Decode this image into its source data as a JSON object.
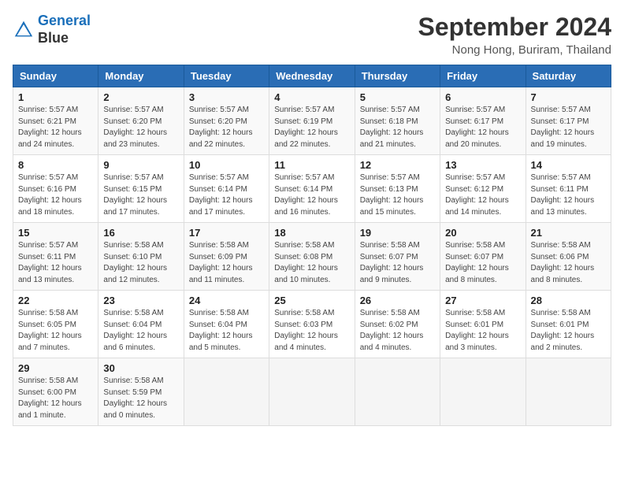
{
  "logo": {
    "line1": "General",
    "line2": "Blue"
  },
  "title": "September 2024",
  "subtitle": "Nong Hong, Buriram, Thailand",
  "days_of_week": [
    "Sunday",
    "Monday",
    "Tuesday",
    "Wednesday",
    "Thursday",
    "Friday",
    "Saturday"
  ],
  "weeks": [
    [
      {
        "day": "1",
        "info": "Sunrise: 5:57 AM\nSunset: 6:21 PM\nDaylight: 12 hours\nand 24 minutes."
      },
      {
        "day": "2",
        "info": "Sunrise: 5:57 AM\nSunset: 6:20 PM\nDaylight: 12 hours\nand 23 minutes."
      },
      {
        "day": "3",
        "info": "Sunrise: 5:57 AM\nSunset: 6:20 PM\nDaylight: 12 hours\nand 22 minutes."
      },
      {
        "day": "4",
        "info": "Sunrise: 5:57 AM\nSunset: 6:19 PM\nDaylight: 12 hours\nand 22 minutes."
      },
      {
        "day": "5",
        "info": "Sunrise: 5:57 AM\nSunset: 6:18 PM\nDaylight: 12 hours\nand 21 minutes."
      },
      {
        "day": "6",
        "info": "Sunrise: 5:57 AM\nSunset: 6:17 PM\nDaylight: 12 hours\nand 20 minutes."
      },
      {
        "day": "7",
        "info": "Sunrise: 5:57 AM\nSunset: 6:17 PM\nDaylight: 12 hours\nand 19 minutes."
      }
    ],
    [
      {
        "day": "8",
        "info": "Sunrise: 5:57 AM\nSunset: 6:16 PM\nDaylight: 12 hours\nand 18 minutes."
      },
      {
        "day": "9",
        "info": "Sunrise: 5:57 AM\nSunset: 6:15 PM\nDaylight: 12 hours\nand 17 minutes."
      },
      {
        "day": "10",
        "info": "Sunrise: 5:57 AM\nSunset: 6:14 PM\nDaylight: 12 hours\nand 17 minutes."
      },
      {
        "day": "11",
        "info": "Sunrise: 5:57 AM\nSunset: 6:14 PM\nDaylight: 12 hours\nand 16 minutes."
      },
      {
        "day": "12",
        "info": "Sunrise: 5:57 AM\nSunset: 6:13 PM\nDaylight: 12 hours\nand 15 minutes."
      },
      {
        "day": "13",
        "info": "Sunrise: 5:57 AM\nSunset: 6:12 PM\nDaylight: 12 hours\nand 14 minutes."
      },
      {
        "day": "14",
        "info": "Sunrise: 5:57 AM\nSunset: 6:11 PM\nDaylight: 12 hours\nand 13 minutes."
      }
    ],
    [
      {
        "day": "15",
        "info": "Sunrise: 5:57 AM\nSunset: 6:11 PM\nDaylight: 12 hours\nand 13 minutes."
      },
      {
        "day": "16",
        "info": "Sunrise: 5:58 AM\nSunset: 6:10 PM\nDaylight: 12 hours\nand 12 minutes."
      },
      {
        "day": "17",
        "info": "Sunrise: 5:58 AM\nSunset: 6:09 PM\nDaylight: 12 hours\nand 11 minutes."
      },
      {
        "day": "18",
        "info": "Sunrise: 5:58 AM\nSunset: 6:08 PM\nDaylight: 12 hours\nand 10 minutes."
      },
      {
        "day": "19",
        "info": "Sunrise: 5:58 AM\nSunset: 6:07 PM\nDaylight: 12 hours\nand 9 minutes."
      },
      {
        "day": "20",
        "info": "Sunrise: 5:58 AM\nSunset: 6:07 PM\nDaylight: 12 hours\nand 8 minutes."
      },
      {
        "day": "21",
        "info": "Sunrise: 5:58 AM\nSunset: 6:06 PM\nDaylight: 12 hours\nand 8 minutes."
      }
    ],
    [
      {
        "day": "22",
        "info": "Sunrise: 5:58 AM\nSunset: 6:05 PM\nDaylight: 12 hours\nand 7 minutes."
      },
      {
        "day": "23",
        "info": "Sunrise: 5:58 AM\nSunset: 6:04 PM\nDaylight: 12 hours\nand 6 minutes."
      },
      {
        "day": "24",
        "info": "Sunrise: 5:58 AM\nSunset: 6:04 PM\nDaylight: 12 hours\nand 5 minutes."
      },
      {
        "day": "25",
        "info": "Sunrise: 5:58 AM\nSunset: 6:03 PM\nDaylight: 12 hours\nand 4 minutes."
      },
      {
        "day": "26",
        "info": "Sunrise: 5:58 AM\nSunset: 6:02 PM\nDaylight: 12 hours\nand 4 minutes."
      },
      {
        "day": "27",
        "info": "Sunrise: 5:58 AM\nSunset: 6:01 PM\nDaylight: 12 hours\nand 3 minutes."
      },
      {
        "day": "28",
        "info": "Sunrise: 5:58 AM\nSunset: 6:01 PM\nDaylight: 12 hours\nand 2 minutes."
      }
    ],
    [
      {
        "day": "29",
        "info": "Sunrise: 5:58 AM\nSunset: 6:00 PM\nDaylight: 12 hours\nand 1 minute."
      },
      {
        "day": "30",
        "info": "Sunrise: 5:58 AM\nSunset: 5:59 PM\nDaylight: 12 hours\nand 0 minutes."
      },
      null,
      null,
      null,
      null,
      null
    ]
  ]
}
